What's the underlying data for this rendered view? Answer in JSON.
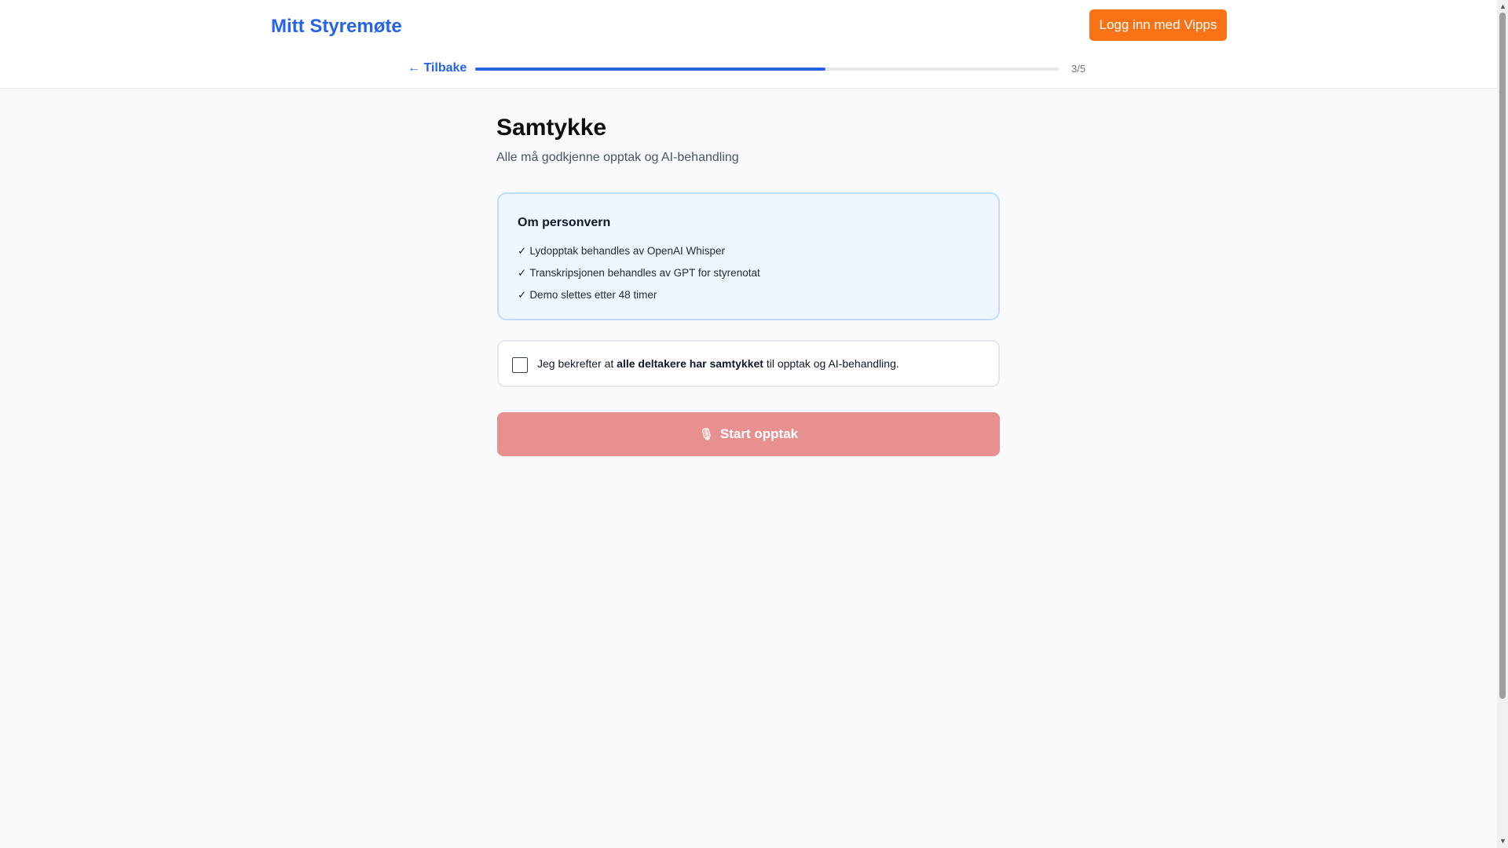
{
  "header": {
    "logo": "Mitt Styremøte",
    "login_button": "Logg inn med Vipps",
    "back_link": "← Tilbake",
    "step": "3/5",
    "progress": 0.6
  },
  "main": {
    "title": "Samtykke",
    "subtitle": "Alle må godkjenne opptak og AI-behandling",
    "privacy": {
      "title": "Om personvern",
      "items": [
        "Lydopptak behandles av OpenAI Whisper",
        "Transkripsjonen behandles av GPT for styrenotat",
        "Demo slettes etter 48 timer"
      ],
      "check_glyph": "✓"
    },
    "consent": {
      "prefix": "Jeg bekrefter at ",
      "bold": "alle deltakere har samtykket",
      "suffix": " til opptak og AI-behandling.",
      "checked": false
    },
    "start_button": {
      "label": "Start opptak",
      "icon": "microphone-icon",
      "disabled": true
    }
  },
  "colors": {
    "brand": "#2563eb",
    "vipps": "#f97316",
    "start_disabled": "#e89090"
  }
}
